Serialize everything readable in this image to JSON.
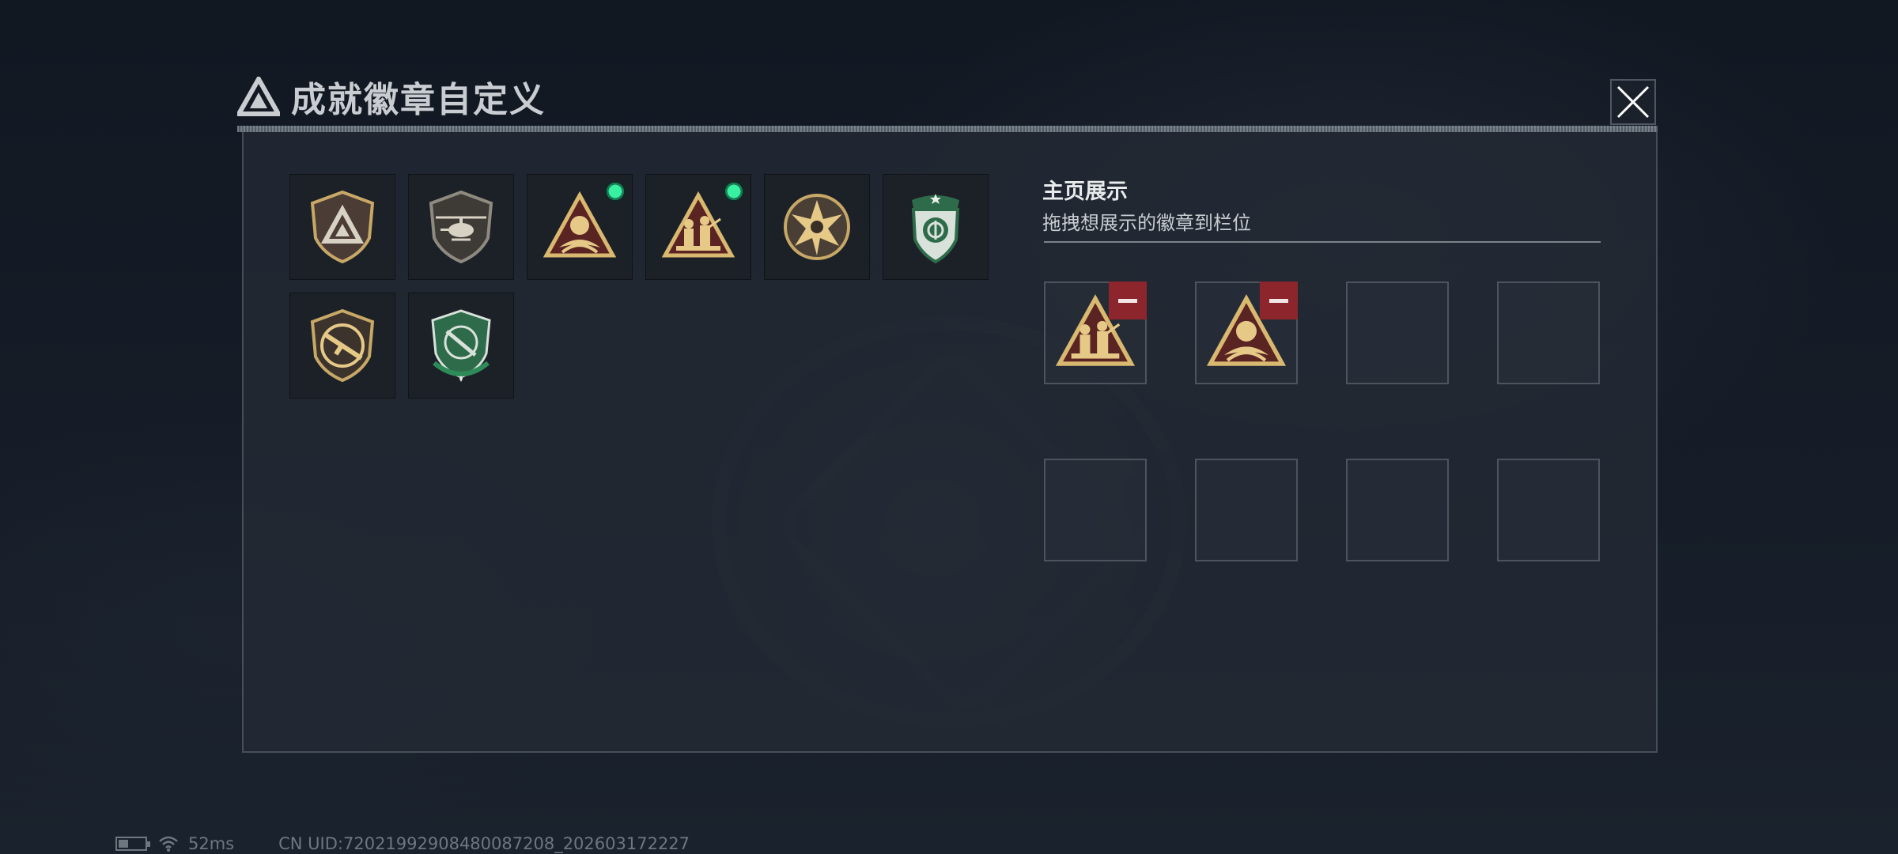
{
  "header": {
    "title": "成就徽章自定义",
    "close_icon": "close-icon"
  },
  "inventory": {
    "badges": [
      {
        "id": 1,
        "icon": "triangle-shield-badge",
        "new": false
      },
      {
        "id": 2,
        "icon": "helicopter-shield-badge",
        "new": false
      },
      {
        "id": 3,
        "icon": "eagle-triangle-badge",
        "new": true
      },
      {
        "id": 4,
        "icon": "soldiers-triangle-badge",
        "new": true
      },
      {
        "id": 5,
        "icon": "star-skull-badge",
        "new": false
      },
      {
        "id": 6,
        "icon": "green-shield-badge",
        "new": false
      },
      {
        "id": 7,
        "icon": "rifle-shield-badge",
        "new": false
      },
      {
        "id": 8,
        "icon": "green-knife-badge",
        "new": false
      }
    ]
  },
  "showcase": {
    "title": "主页展示",
    "subtitle": "拖拽想展示的徽章到栏位",
    "slots": [
      {
        "badge": "soldiers-triangle-badge",
        "removable": true
      },
      {
        "badge": "eagle-triangle-badge",
        "removable": true
      },
      {
        "badge": null
      },
      {
        "badge": null
      },
      {
        "badge": null
      },
      {
        "badge": null
      },
      {
        "badge": null
      },
      {
        "badge": null
      }
    ]
  },
  "status": {
    "ping": "52ms",
    "uid": "CN UID:7202199290848008720​8_202603172227"
  },
  "colors": {
    "accent_new": "#38f0a0",
    "remove": "#8c262c",
    "gold": "#c7a866",
    "green": "#2e6b4a"
  }
}
